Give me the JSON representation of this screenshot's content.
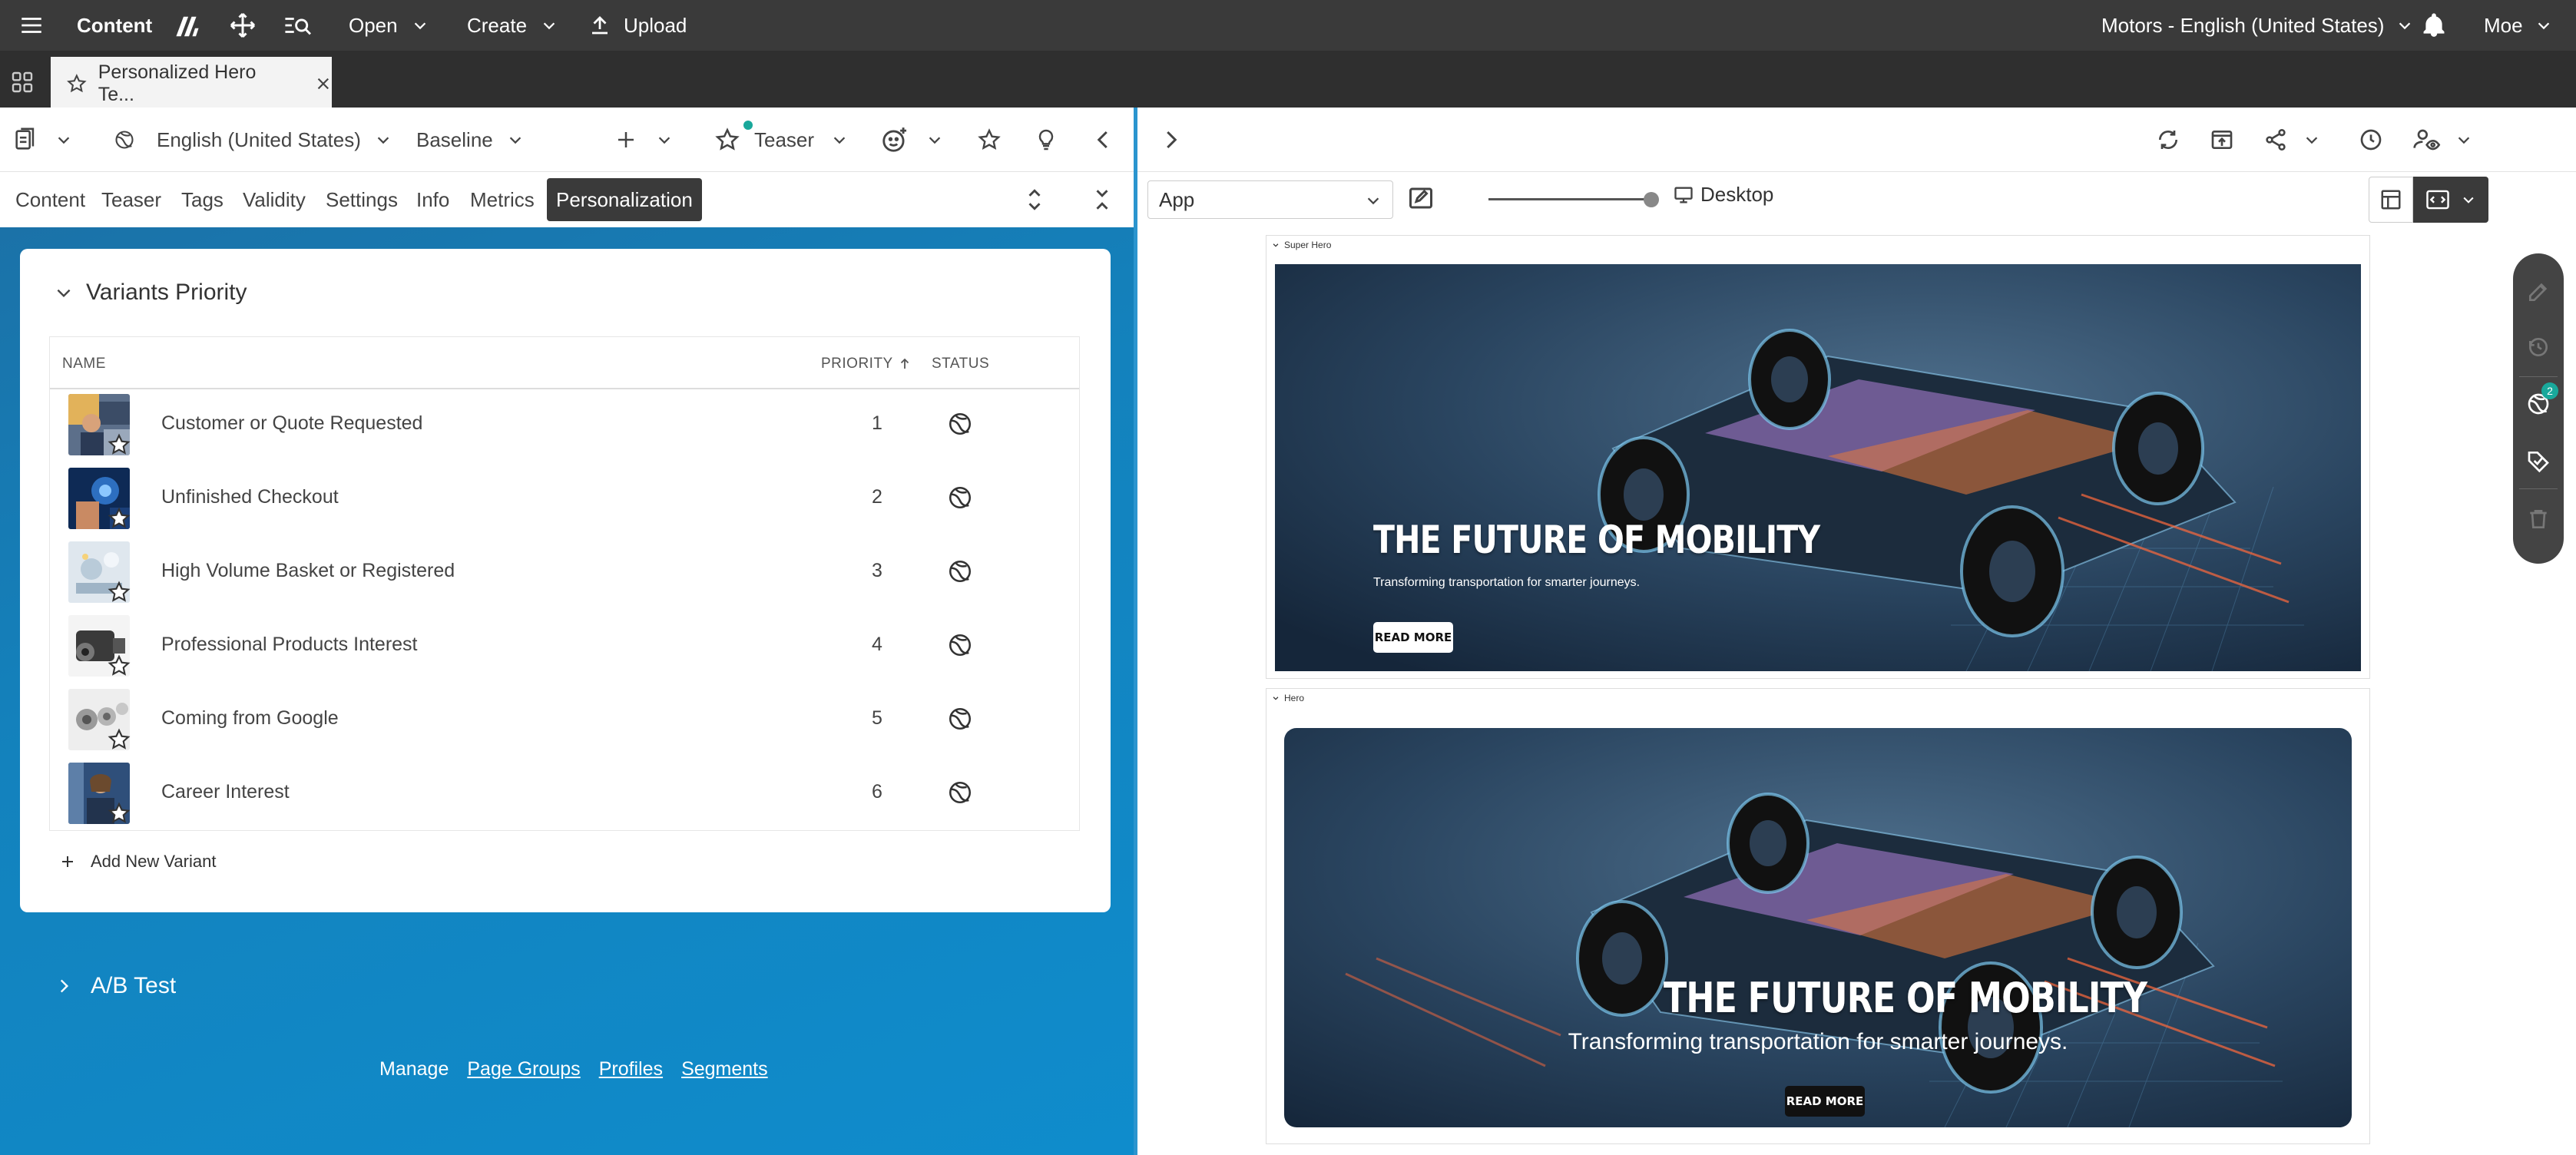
{
  "topbar": {
    "app_title": "Content",
    "open_label": "Open",
    "create_label": "Create",
    "upload_label": "Upload",
    "site_label": "Motors - English (United States)",
    "user_label": "Moe"
  },
  "tab": {
    "title": "Personalized Hero Te..."
  },
  "left_toolbar": {
    "locale": "English (United States)",
    "version": "Baseline",
    "doc_type": "Teaser"
  },
  "left_tabs": [
    "Content",
    "Teaser",
    "Tags",
    "Validity",
    "Settings",
    "Info",
    "Metrics",
    "Personalization"
  ],
  "variants": {
    "title": "Variants Priority",
    "columns": {
      "name": "NAME",
      "priority": "PRIORITY",
      "status": "STATUS"
    },
    "rows": [
      {
        "name": "Customer or Quote Requested",
        "priority": "1",
        "thumb": "people-meeting"
      },
      {
        "name": "Unfinished Checkout",
        "priority": "2",
        "thumb": "hand-tech"
      },
      {
        "name": "High Volume Basket or Registered",
        "priority": "3",
        "thumb": "light-tech"
      },
      {
        "name": "Professional Products Interest",
        "priority": "4",
        "thumb": "engine"
      },
      {
        "name": "Coming from Google",
        "priority": "5",
        "thumb": "gears"
      },
      {
        "name": "Career Interest",
        "priority": "6",
        "thumb": "person-office"
      }
    ],
    "add_label": "Add New Variant"
  },
  "ab_test": {
    "label": "A/B Test"
  },
  "manage": {
    "label": "Manage",
    "links": [
      "Page Groups",
      "Profiles",
      "Segments"
    ]
  },
  "preview": {
    "app_select": "App",
    "device_label": "Desktop",
    "super_hero": {
      "frame_label": "Super Hero",
      "headline": "THE FUTURE OF MOBILITY",
      "subline": "Transforming transportation for smarter journeys.",
      "button": "READ MORE"
    },
    "hero": {
      "frame_label": "Hero",
      "headline": "THE FUTURE OF MOBILITY",
      "subline": "Transforming transportation for smarter journeys.",
      "button": "READ MORE"
    },
    "rail_badge": "2"
  },
  "colors": {
    "topbar": "#3a3a3a",
    "left_gradient": "#1382bd",
    "teal_dot": "#19a89b"
  }
}
